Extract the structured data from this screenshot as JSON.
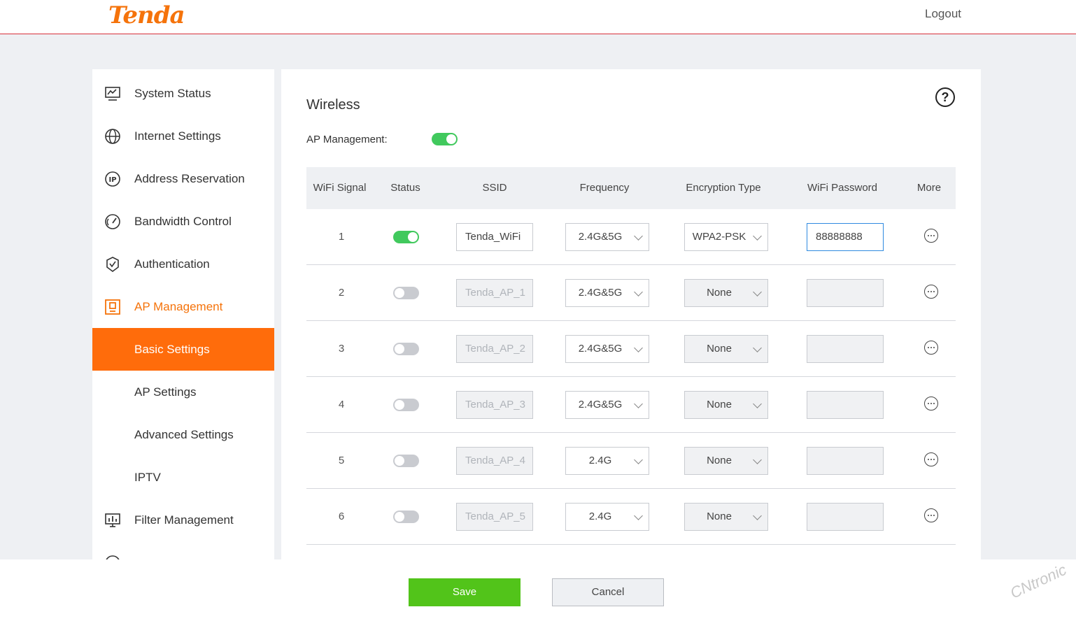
{
  "header": {
    "brand": "Tenda",
    "logout": "Logout"
  },
  "sidebar": {
    "items": [
      {
        "label": "System Status",
        "icon": "monitor-chart-icon"
      },
      {
        "label": "Internet Settings",
        "icon": "globe-icon"
      },
      {
        "label": "Address Reservation",
        "icon": "ip-icon"
      },
      {
        "label": "Bandwidth Control",
        "icon": "gauge-icon"
      },
      {
        "label": "Authentication",
        "icon": "shield-check-icon"
      },
      {
        "label": "AP Management",
        "icon": "ap-device-icon"
      },
      {
        "label": "Basic Settings"
      },
      {
        "label": "AP Settings"
      },
      {
        "label": "Advanced Settings"
      },
      {
        "label": "IPTV"
      },
      {
        "label": "Filter Management",
        "icon": "filter-board-icon"
      }
    ]
  },
  "main": {
    "title": "Wireless",
    "ap_management_label": "AP Management:",
    "ap_management_enabled": true,
    "columns": [
      "WiFi Signal",
      "Status",
      "SSID",
      "Frequency",
      "Encryption Type",
      "WiFi Password",
      "More"
    ],
    "rows": [
      {
        "signal": "1",
        "enabled": true,
        "ssid": "Tenda_WiFi",
        "frequency": "2.4G&5G",
        "encryption": "WPA2-PSK",
        "password": "88888888"
      },
      {
        "signal": "2",
        "enabled": false,
        "ssid": "Tenda_AP_1",
        "frequency": "2.4G&5G",
        "encryption": "None",
        "password": ""
      },
      {
        "signal": "3",
        "enabled": false,
        "ssid": "Tenda_AP_2",
        "frequency": "2.4G&5G",
        "encryption": "None",
        "password": ""
      },
      {
        "signal": "4",
        "enabled": false,
        "ssid": "Tenda_AP_3",
        "frequency": "2.4G&5G",
        "encryption": "None",
        "password": ""
      },
      {
        "signal": "5",
        "enabled": false,
        "ssid": "Tenda_AP_4",
        "frequency": "2.4G",
        "encryption": "None",
        "password": ""
      },
      {
        "signal": "6",
        "enabled": false,
        "ssid": "Tenda_AP_5",
        "frequency": "2.4G",
        "encryption": "None",
        "password": ""
      }
    ]
  },
  "footer": {
    "save": "Save",
    "cancel": "Cancel"
  },
  "watermark": "CNtronic",
  "colors": {
    "brand": "#f5730b",
    "toggle_on": "#41c95d",
    "save": "#52c41a",
    "selected_nav": "#ff6c0b"
  }
}
